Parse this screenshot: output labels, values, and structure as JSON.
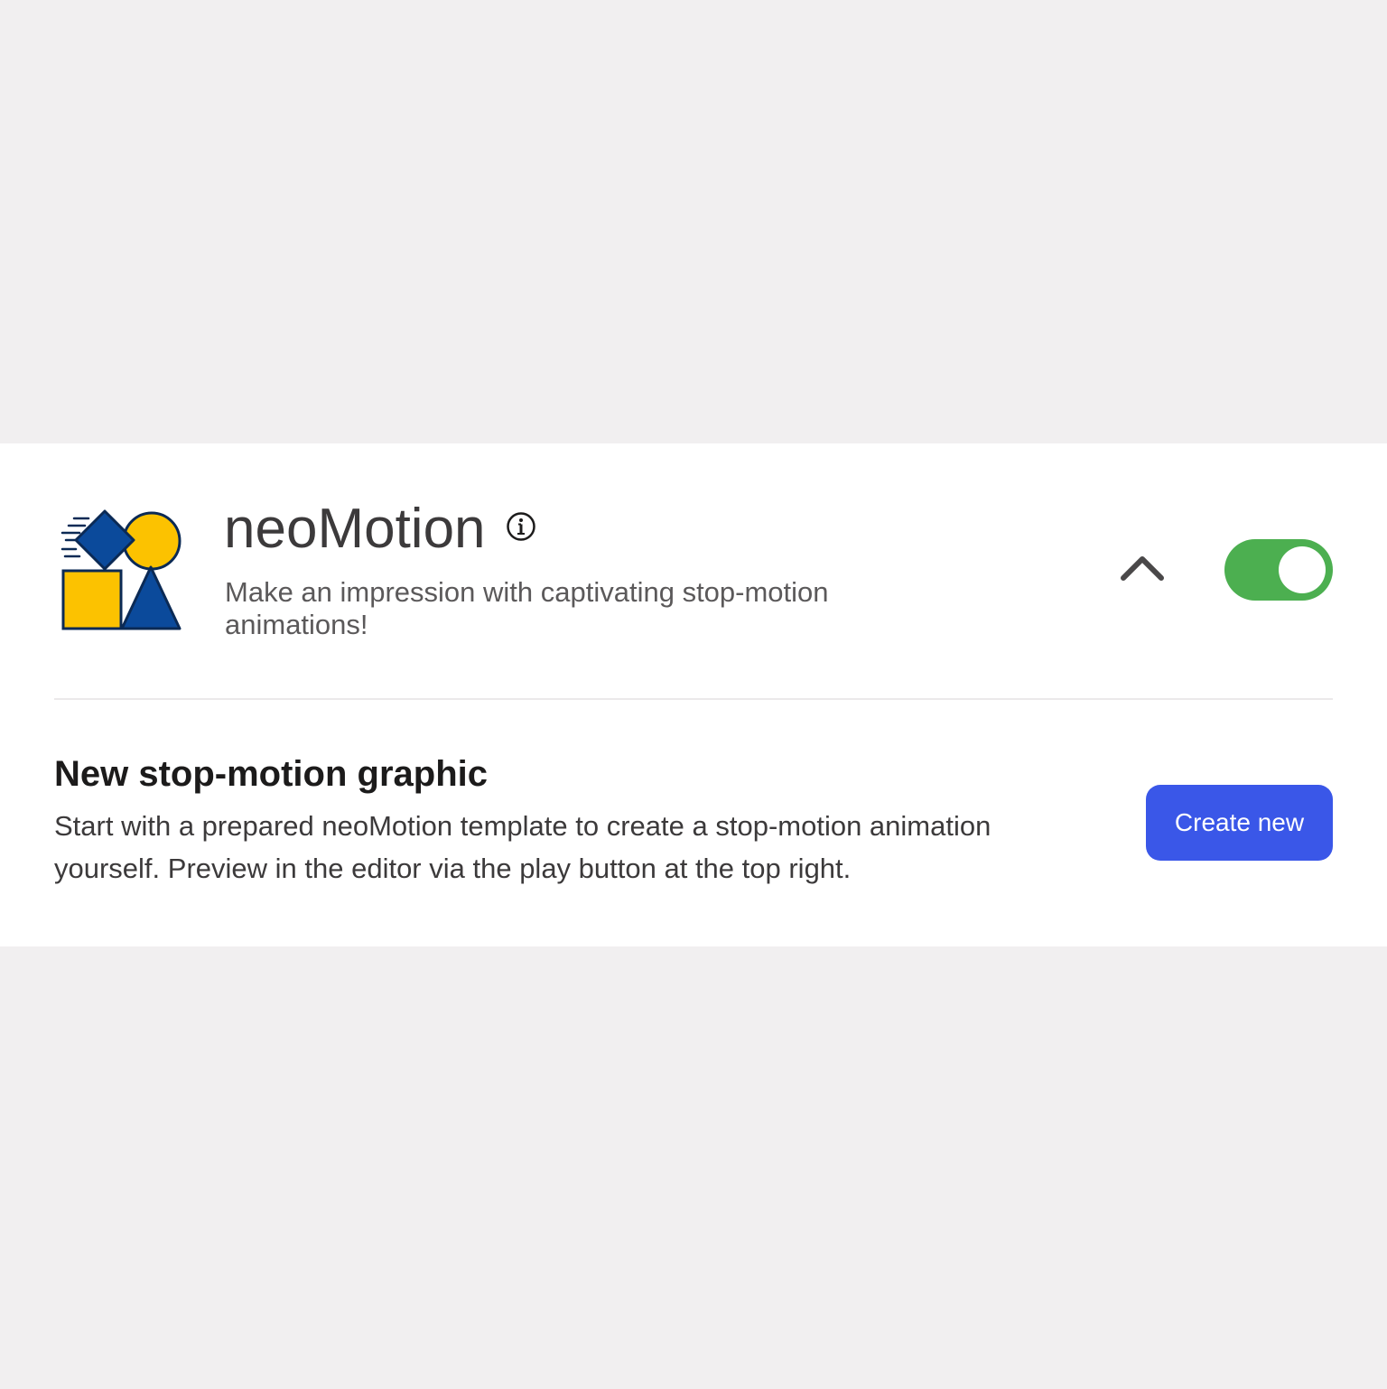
{
  "plugin": {
    "icon": "neomotion-shapes-icon",
    "title": "neoMotion",
    "description": "Make an impression with captivating stop-motion animations!",
    "info_icon": "info-icon",
    "collapse_icon": "chevron-up-icon",
    "enabled": true
  },
  "section": {
    "title": "New stop-motion graphic",
    "description": "Start with a prepared neoMotion template to create a stop-motion animation yourself. Preview in the editor via the play button at the top right.",
    "button_label": "Create new"
  },
  "colors": {
    "page_background": "#f1eff0",
    "card_background": "#ffffff",
    "toggle_on": "#4caf50",
    "primary_button": "#3a57e8",
    "icon_blue": "#0b4a9b",
    "icon_yellow": "#fcc200"
  }
}
